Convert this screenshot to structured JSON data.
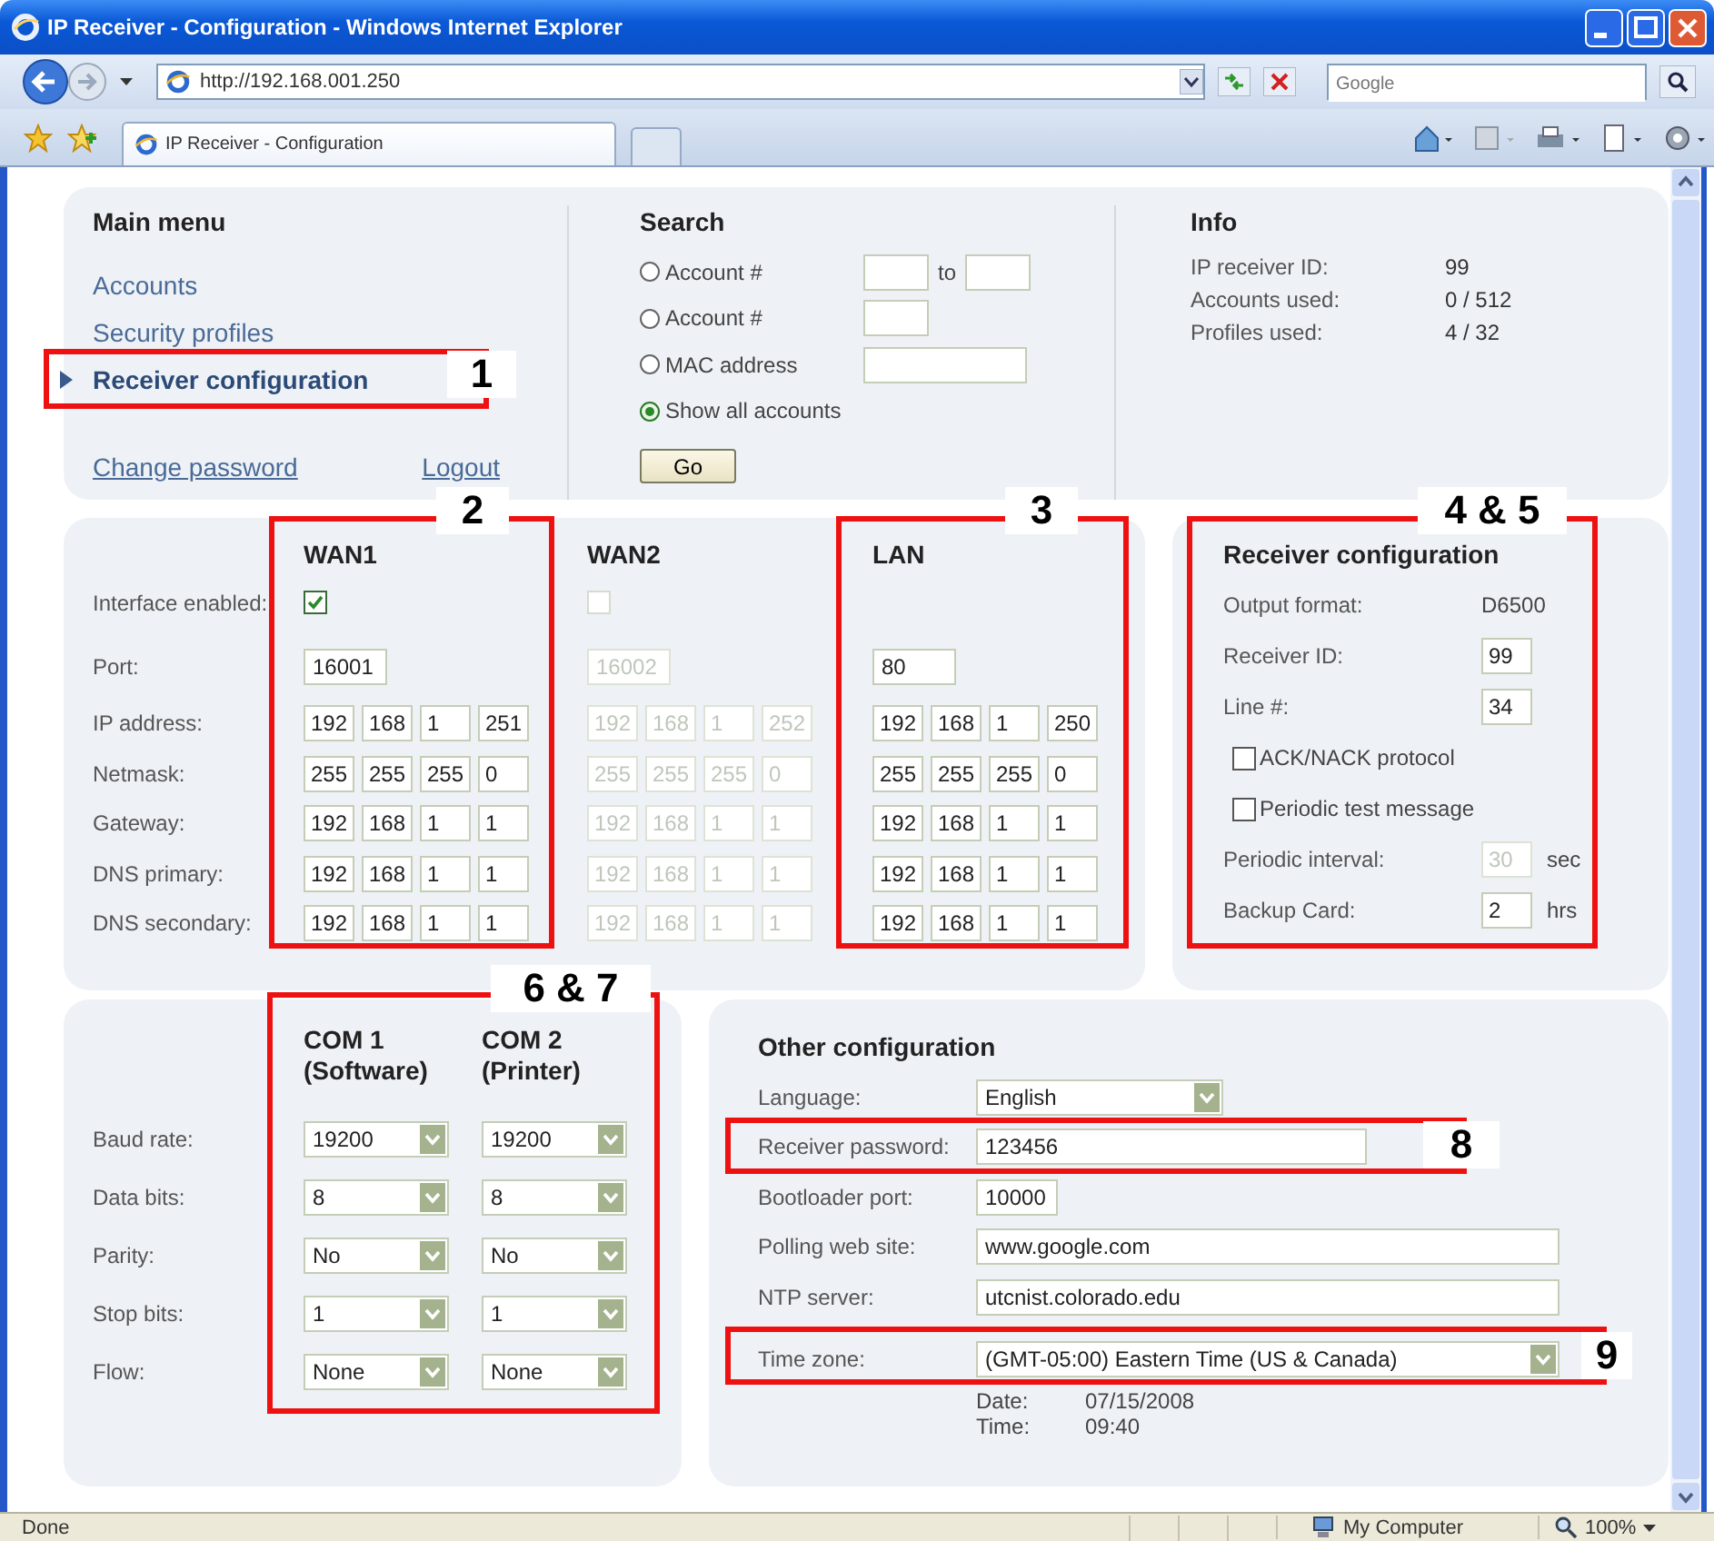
{
  "window": {
    "title": "IP Receiver - Configuration - Windows Internet Explorer"
  },
  "address_bar": {
    "url": "http://192.168.001.250"
  },
  "search_box": {
    "placeholder": "Google"
  },
  "tabs": [
    {
      "label": "IP Receiver - Configuration",
      "selected": true
    }
  ],
  "main_menu": {
    "title": "Main menu",
    "items": [
      {
        "label": "Accounts",
        "selected": false
      },
      {
        "label": "Security profiles",
        "selected": false
      },
      {
        "label": "Receiver configuration",
        "selected": true
      }
    ],
    "links": [
      "Change password",
      "Logout"
    ]
  },
  "search": {
    "title": "Search",
    "options": [
      {
        "kind": "range",
        "label": "Account #",
        "connector": "to",
        "selected": false
      },
      {
        "kind": "single",
        "label": "Account #",
        "selected": false
      },
      {
        "kind": "wide",
        "label": "MAC address",
        "selected": false
      },
      {
        "kind": "none",
        "label": "Show all accounts",
        "selected": true
      }
    ],
    "button": "Go"
  },
  "info": {
    "title": "Info",
    "rows": [
      {
        "label": "IP receiver ID:",
        "value": "99"
      },
      {
        "label": "Accounts used:",
        "value": "0 / 512"
      },
      {
        "label": "Profiles used:",
        "value": "4 / 32"
      }
    ]
  },
  "interfaces": {
    "labels": [
      "Interface enabled:",
      "Port:",
      "IP address:",
      "Netmask:",
      "Gateway:",
      "DNS primary:",
      "DNS secondary:"
    ],
    "columns": [
      {
        "name": "WAN1",
        "enabled": {
          "checked": true
        },
        "disabled": false,
        "port": "16001",
        "addresses": [
          [
            "192",
            "168",
            "1",
            "251"
          ],
          [
            "255",
            "255",
            "255",
            "0"
          ],
          [
            "192",
            "168",
            "1",
            "1"
          ],
          [
            "192",
            "168",
            "1",
            "1"
          ],
          [
            "192",
            "168",
            "1",
            "1"
          ]
        ]
      },
      {
        "name": "WAN2",
        "enabled": {
          "checked": false
        },
        "disabled": true,
        "port": "16002",
        "addresses": [
          [
            "192",
            "168",
            "1",
            "252"
          ],
          [
            "255",
            "255",
            "255",
            "0"
          ],
          [
            "192",
            "168",
            "1",
            "1"
          ],
          [
            "192",
            "168",
            "1",
            "1"
          ],
          [
            "192",
            "168",
            "1",
            "1"
          ]
        ]
      },
      {
        "name": "LAN",
        "disabled": false,
        "port": "80",
        "addresses": [
          [
            "192",
            "168",
            "1",
            "250"
          ],
          [
            "255",
            "255",
            "255",
            "0"
          ],
          [
            "192",
            "168",
            "1",
            "1"
          ],
          [
            "192",
            "168",
            "1",
            "1"
          ],
          [
            "192",
            "168",
            "1",
            "1"
          ]
        ]
      }
    ]
  },
  "receiver_config": {
    "title": "Receiver configuration",
    "rows": [
      {
        "kind": "value",
        "label": "Output format:",
        "value": "D6500"
      },
      {
        "kind": "input",
        "label": "Receiver ID:",
        "value": "99",
        "disabled": false
      },
      {
        "kind": "input",
        "label": "Line #:",
        "value": "34",
        "disabled": false
      },
      {
        "kind": "checkbox",
        "label": "ACK/NACK protocol",
        "checked": false
      },
      {
        "kind": "checkbox",
        "label": "Periodic test message",
        "checked": false
      },
      {
        "kind": "input",
        "label": "Periodic interval:",
        "value": "30",
        "unit": "sec",
        "disabled": true
      },
      {
        "kind": "input",
        "label": "Backup Card:",
        "value": "2",
        "unit": "hrs",
        "disabled": false
      }
    ]
  },
  "serial_ports": {
    "labels": [
      "Baud rate:",
      "Data bits:",
      "Parity:",
      "Stop bits:",
      "Flow:"
    ],
    "columns": [
      {
        "name": "COM 1",
        "subtitle": "(Software)",
        "values": [
          "19200",
          "8",
          "No",
          "1",
          "None"
        ]
      },
      {
        "name": "COM 2",
        "subtitle": "(Printer)",
        "values": [
          "19200",
          "8",
          "No",
          "1",
          "None"
        ]
      }
    ]
  },
  "other_config": {
    "title": "Other configuration",
    "rows": [
      {
        "kind": "select",
        "label": "Language:",
        "value": "English"
      },
      {
        "kind": "password",
        "label": "Receiver password:",
        "value": "123456"
      },
      {
        "kind": "short",
        "label": "Bootloader port:",
        "value": "10000"
      },
      {
        "kind": "text",
        "label": "Polling web site:",
        "value": "www.google.com"
      },
      {
        "kind": "text",
        "label": "NTP server:",
        "value": "utcnist.colorado.edu"
      },
      {
        "kind": "wide-select",
        "label": "Time zone:",
        "value": "(GMT-05:00) Eastern Time (US & Canada)"
      }
    ],
    "timestamp": [
      {
        "label": "Date:",
        "value": "07/15/2008"
      },
      {
        "label": "Time:",
        "value": "09:40"
      }
    ]
  },
  "callouts": [
    {
      "label": "1"
    },
    {
      "label": "2"
    },
    {
      "label": "3"
    },
    {
      "label": "4 & 5"
    },
    {
      "label": "6 & 7"
    },
    {
      "label": "8"
    },
    {
      "label": "9"
    }
  ],
  "status_bar": {
    "text": "Done",
    "zone": "My Computer",
    "zoom": "100%"
  }
}
